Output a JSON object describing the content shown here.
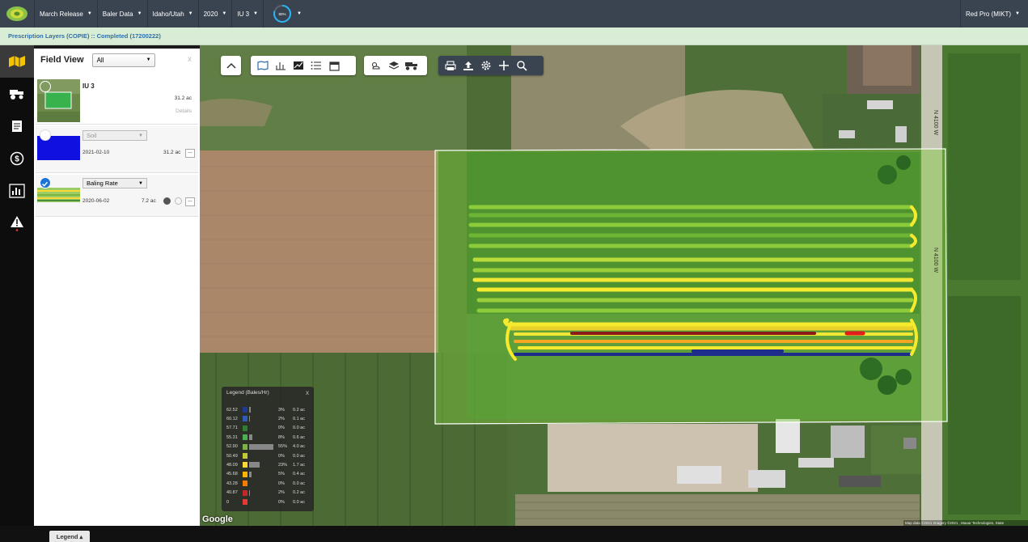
{
  "topbar": {
    "items": [
      {
        "label": "March Release"
      },
      {
        "label": "Baler Data"
      },
      {
        "label": "Idaho/Utah"
      },
      {
        "label": "2020"
      },
      {
        "label": "IU 3"
      }
    ],
    "progress_label": "80%",
    "progress_value": 0.8,
    "account": "Red Pro (MIKT)"
  },
  "subbar": {
    "text": "Prescription Layers (COPIE) :: Completed (17200222)"
  },
  "panel": {
    "title": "Field View",
    "filter": "All",
    "close": "x",
    "field": {
      "name": "IU 3",
      "area": "31.2 ac",
      "details": "Details"
    },
    "soil": {
      "layer": "Soil",
      "date": "2021-02-10",
      "area": "31.2 ac",
      "more": "..."
    },
    "baling": {
      "layer": "Baling Rate",
      "date": "2020-06-02",
      "area": "7.2 ac",
      "more": "..."
    }
  },
  "legend": {
    "title": "Legend (Bales/Hr)",
    "close": "x",
    "rows": [
      {
        "value": "62.52",
        "color": "#1f3a93",
        "pct": "3%",
        "area": "0.2 ac",
        "share": 0.03
      },
      {
        "value": "60.12",
        "color": "#2d5db8",
        "pct": "2%",
        "area": "0.1 ac",
        "share": 0.02
      },
      {
        "value": "57.71",
        "color": "#2e7d32",
        "pct": "0%",
        "area": "0.0 ac",
        "share": 0.0
      },
      {
        "value": "55.31",
        "color": "#4caf50",
        "pct": "8%",
        "area": "0.6 ac",
        "share": 0.08
      },
      {
        "value": "52.90",
        "color": "#7cb342",
        "pct": "55%",
        "area": "4.0 ac",
        "share": 0.55
      },
      {
        "value": "50.49",
        "color": "#c0ca33",
        "pct": "0%",
        "area": "0.0 ac",
        "share": 0.0
      },
      {
        "value": "48.09",
        "color": "#fdd835",
        "pct": "23%",
        "area": "1.7 ac",
        "share": 0.23
      },
      {
        "value": "45.68",
        "color": "#ffb300",
        "pct": "5%",
        "area": "0.4 ac",
        "share": 0.05
      },
      {
        "value": "43.28",
        "color": "#f57c00",
        "pct": "0%",
        "area": "0.0 ac",
        "share": 0.0
      },
      {
        "value": "40.87",
        "color": "#c62828",
        "pct": "2%",
        "area": "0.2 ac",
        "share": 0.02
      },
      {
        "value": "0",
        "color": "#e53935",
        "pct": "0%",
        "area": "0.0 ac",
        "share": 0.0
      }
    ]
  },
  "map": {
    "road_label": "N 4100 W",
    "google": "Google",
    "attribution": "Map data ©2021 Imagery ©2021 , Maxar Technologies, State"
  },
  "bottom": {
    "legend_button": "Legend ▴"
  }
}
